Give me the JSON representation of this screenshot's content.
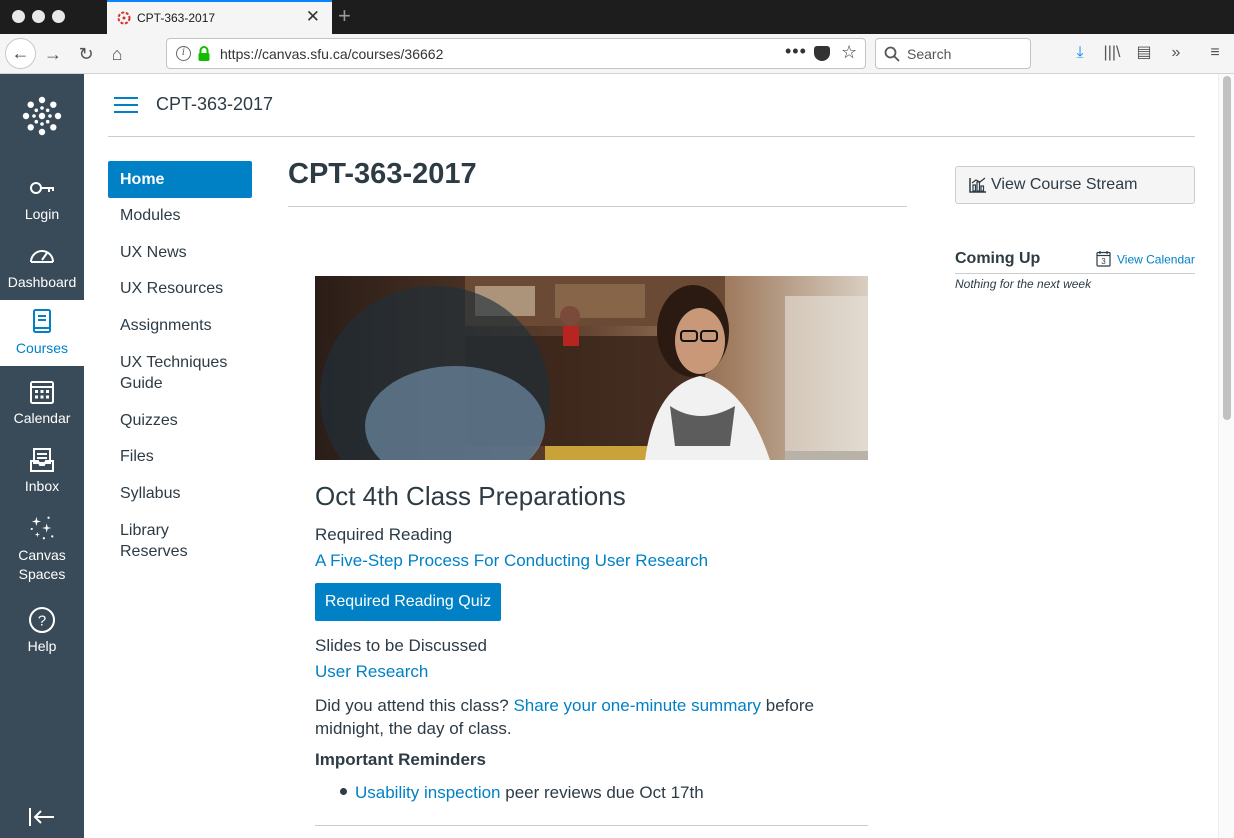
{
  "browser": {
    "tab_title": "CPT-363-2017",
    "url": "https://canvas.sfu.ca/courses/36662",
    "search_placeholder": "Search"
  },
  "global_nav": {
    "items": [
      {
        "label": "Login",
        "icon": "key-icon"
      },
      {
        "label": "Dashboard",
        "icon": "speedometer-icon"
      },
      {
        "label": "Courses",
        "icon": "book-icon",
        "active": true
      },
      {
        "label": "Calendar",
        "icon": "calendar-icon"
      },
      {
        "label": "Inbox",
        "icon": "inbox-icon"
      },
      {
        "label": "Canvas Spaces",
        "icon": "sparkle-icon"
      },
      {
        "label": "Help",
        "icon": "help-icon"
      }
    ],
    "canvas_spaces_line1": "Canvas",
    "canvas_spaces_line2": "Spaces"
  },
  "header": {
    "breadcrumb": "CPT-363-2017"
  },
  "course_nav": {
    "items": [
      {
        "label": "Home",
        "active": true
      },
      {
        "label": "Modules"
      },
      {
        "label": "UX News"
      },
      {
        "label": "UX Resources"
      },
      {
        "label": "Assignments"
      },
      {
        "label": "UX Techniques Guide"
      },
      {
        "label": "Quizzes"
      },
      {
        "label": "Files"
      },
      {
        "label": "Syllabus"
      },
      {
        "label": "Library Reserves"
      }
    ]
  },
  "main": {
    "title": "CPT-363-2017",
    "section_heading": "Oct 4th Class Preparations",
    "required_reading_label": "Required Reading",
    "required_reading_link": "A Five-Step Process For Conducting User Research",
    "quiz_button": "Required Reading Quiz",
    "slides_label": "Slides to be Discussed",
    "slides_link": "User Research",
    "attend_prefix": "Did you attend this class?",
    "attend_link": "Share your one-minute summary",
    "attend_suffix": "before midnight, the day of class.",
    "reminders_heading": "Important Reminders",
    "reminder_link": "Usability inspection",
    "reminder_text": "peer reviews due Oct 17th"
  },
  "sidebar": {
    "stream_button": "View Course Stream",
    "coming_up_title": "Coming Up",
    "view_calendar": "View Calendar",
    "calendar_day": "3",
    "coming_up_empty": "Nothing for the next week"
  },
  "colors": {
    "accent": "#0081c6",
    "global_nav_bg": "#394b58",
    "text": "#2d3b45"
  }
}
